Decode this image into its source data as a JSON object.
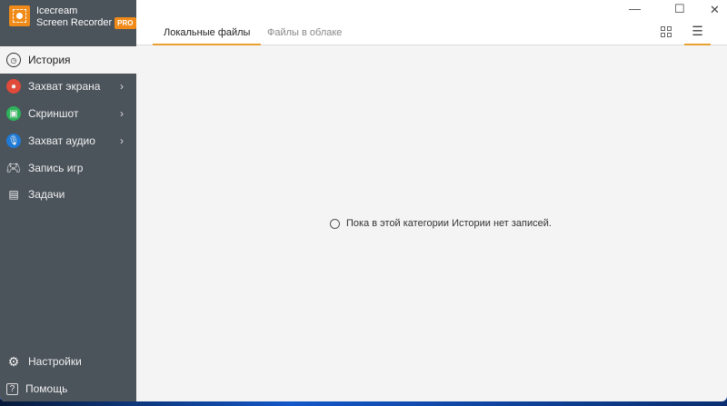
{
  "app": {
    "name_line1": "Icecream",
    "name_line2": "Screen Recorder",
    "badge": "PRO"
  },
  "sidebar": {
    "items": [
      {
        "label": "История",
        "icon": "clock-icon"
      },
      {
        "label": "Захват экрана",
        "icon": "record-icon",
        "color": "#e04a3a"
      },
      {
        "label": "Скриншот",
        "icon": "camera-icon",
        "color": "#2db35a"
      },
      {
        "label": "Захват аудио",
        "icon": "microphone-icon",
        "color": "#1f7ad6"
      },
      {
        "label": "Запись игр",
        "icon": "gamepad-icon"
      },
      {
        "label": "Задачи",
        "icon": "tasks-icon"
      }
    ],
    "bottom": [
      {
        "label": "Настройки",
        "icon": "gear-icon"
      },
      {
        "label": "Помощь",
        "icon": "help-icon"
      }
    ]
  },
  "tabs": [
    {
      "label": "Локальные файлы"
    },
    {
      "label": "Файлы в облаке"
    }
  ],
  "empty_message": "Пока в этой категории Истории нет записей.",
  "window": {
    "minimize": "—",
    "maximize": "☐",
    "close": "✕"
  },
  "accent": "#e8a030"
}
